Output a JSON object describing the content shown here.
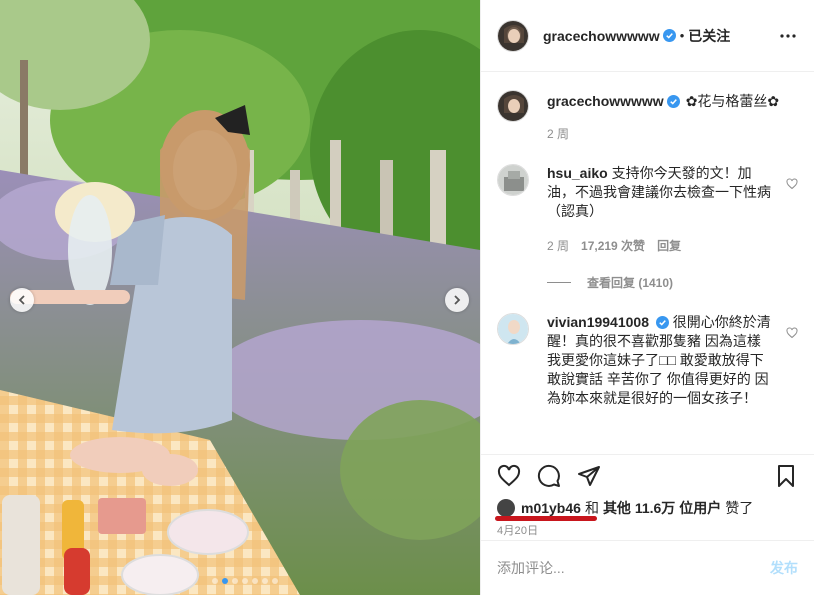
{
  "colors": {
    "accent": "#3897f0",
    "muted": "#8e8e8e",
    "text": "#262626",
    "post_button_disabled": "#b2dffc",
    "annotation_underline": "#c8161d"
  },
  "header": {
    "username": "gracechowwwww",
    "separator": "•",
    "follow_state": "已关注",
    "more_icon": "more-horizontal-icon"
  },
  "caption": {
    "username": "gracechowwwww",
    "text": "✿花与格蕾丝✿",
    "time": "2 周"
  },
  "comments": [
    {
      "username": "hsu_aiko",
      "text": "支持你今天發的文！加油，不過我會建議你去檢查一下性病（認真）",
      "time": "2 周",
      "likes": "17,219 次赞",
      "reply": "回复",
      "view_replies": "查看回复 (1410)"
    },
    {
      "username": "vivian19941008",
      "text": "很開心你終於清醒！真的很不喜歡那隻豬 因為這樣我更愛你這妹子了□□ 敢愛敢放得下敢說實話 辛苦你了 你值得更好的 因為妳本來就是很好的一個女孩子！"
    }
  ],
  "likes_line": {
    "user": "m01yb46",
    "connector": "和",
    "others": "其他 11.6万 位用户",
    "suffix": "赞了"
  },
  "date": "4月20日",
  "add_comment": {
    "placeholder": "添加评论...",
    "post_label": "发布"
  },
  "carousel": {
    "total": 7,
    "active_index": 1
  }
}
